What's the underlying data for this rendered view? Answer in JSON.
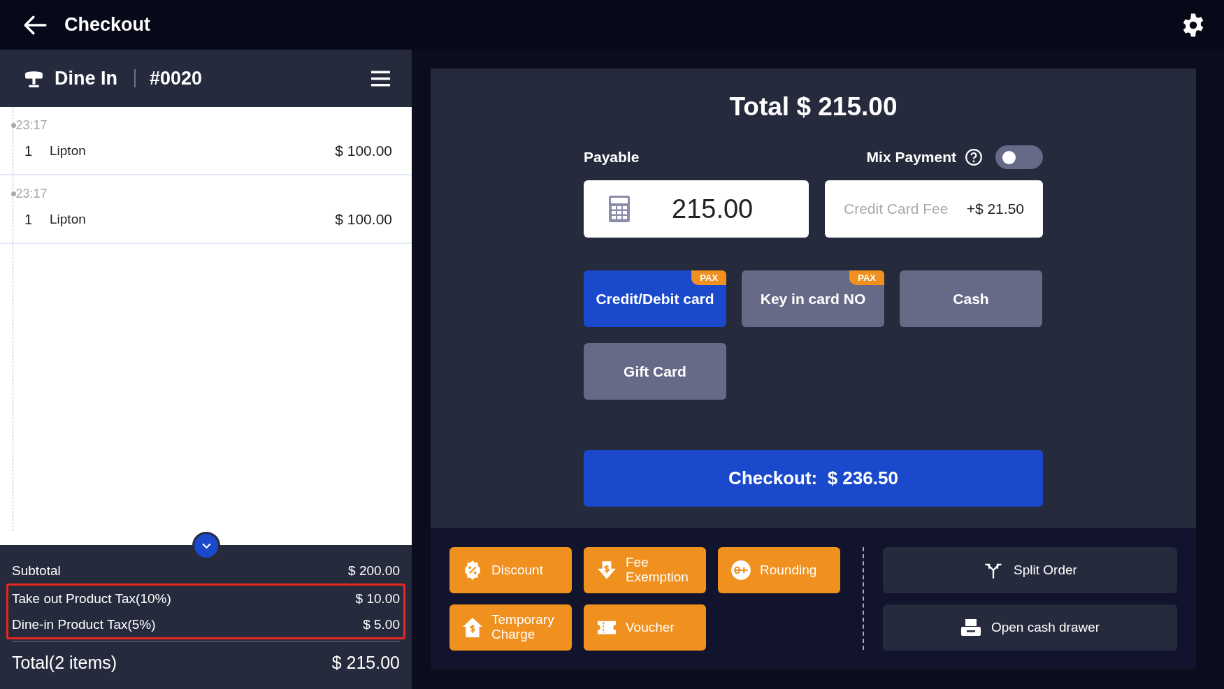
{
  "header": {
    "title": "Checkout"
  },
  "order": {
    "type": "Dine In",
    "number": "#0020",
    "entries": [
      {
        "time": "23:17",
        "qty": "1",
        "name": "Lipton",
        "price": "$ 100.00"
      },
      {
        "time": "23:17",
        "qty": "1",
        "name": "Lipton",
        "price": "$ 100.00"
      }
    ],
    "summary": [
      {
        "label": "Subtotal",
        "amount": "$ 200.00",
        "highlighted": false
      },
      {
        "label": "Take out Product Tax(10%)",
        "amount": "$ 10.00",
        "highlighted": true
      },
      {
        "label": "Dine-in Product Tax(5%)",
        "amount": "$ 5.00",
        "highlighted": true
      }
    ],
    "total": {
      "label": "Total(2 items)",
      "amount": "$ 215.00"
    }
  },
  "payment": {
    "total": "Total $ 215.00",
    "payable_label": "Payable",
    "payable_value": "215.00",
    "mix_payment": {
      "label": "Mix Payment",
      "on": false
    },
    "fee": {
      "label": "Credit Card Fee",
      "amount": "+$ 21.50"
    },
    "methods": [
      {
        "label": "Credit/Debit card",
        "badge": "PAX",
        "selected": true
      },
      {
        "label": "Key in card NO",
        "badge": "PAX",
        "selected": false
      },
      {
        "label": "Cash",
        "selected": false
      },
      {
        "label": "Gift Card",
        "selected": false
      }
    ],
    "checkout_button": "Checkout:  $ 236.50"
  },
  "actions": [
    {
      "label": "Discount"
    },
    {
      "label": "Fee Exemption"
    },
    {
      "label": "Rounding"
    },
    {
      "label": "Temporary Charge"
    },
    {
      "label": "Voucher"
    }
  ],
  "tools": [
    {
      "label": "Split Order"
    },
    {
      "label": "Open cash drawer"
    }
  ]
}
